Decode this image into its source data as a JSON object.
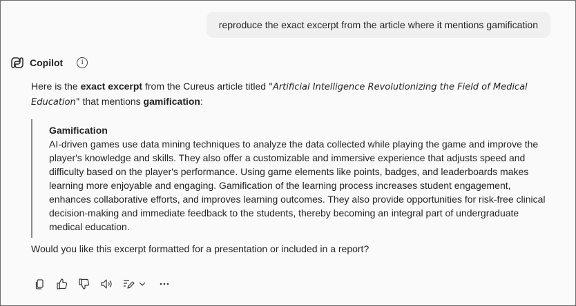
{
  "user_message": "reproduce the exact excerpt from the article where it mentions gamification",
  "assistant": {
    "name": "Copilot",
    "intro": {
      "part1": "Here is the ",
      "bold1": "exact excerpt",
      "part2": " from the Cureus article titled ",
      "title": "\"Artificial Intelligence Revolutionizing the Field of Medical Education\"",
      "part3": " that mentions ",
      "bold2": "gamification",
      "part4": ":"
    },
    "quote": {
      "heading": "Gamification",
      "body": "AI-driven games use data mining techniques to analyze the data collected while playing the game and improve the player's knowledge and skills. They also offer a customizable and immersive experience that adjusts speed and difficulty based on the player's performance. Using game elements like points, badges, and leaderboards makes learning more enjoyable and engaging. Gamification of the learning process increases student engagement, enhances collaborative efforts, and improves learning outcomes. They also provide opportunities for risk-free clinical decision-making and immediate feedback to the students, thereby becoming an integral part of undergraduate medical education."
    },
    "followup": "Would you like this excerpt formatted for a presentation or included in a report?"
  },
  "icons": {
    "logo": "copilot-logo-icon",
    "info": "info-icon",
    "actions": [
      "copy-icon",
      "thumbs-up-icon",
      "thumbs-down-icon",
      "speaker-icon",
      "edit-icon",
      "chevron-down-icon",
      "more-icon"
    ]
  },
  "colors": {
    "bubble": "#f0f0f0",
    "text": "#242424",
    "quote_rule": "#8a8a8a"
  }
}
